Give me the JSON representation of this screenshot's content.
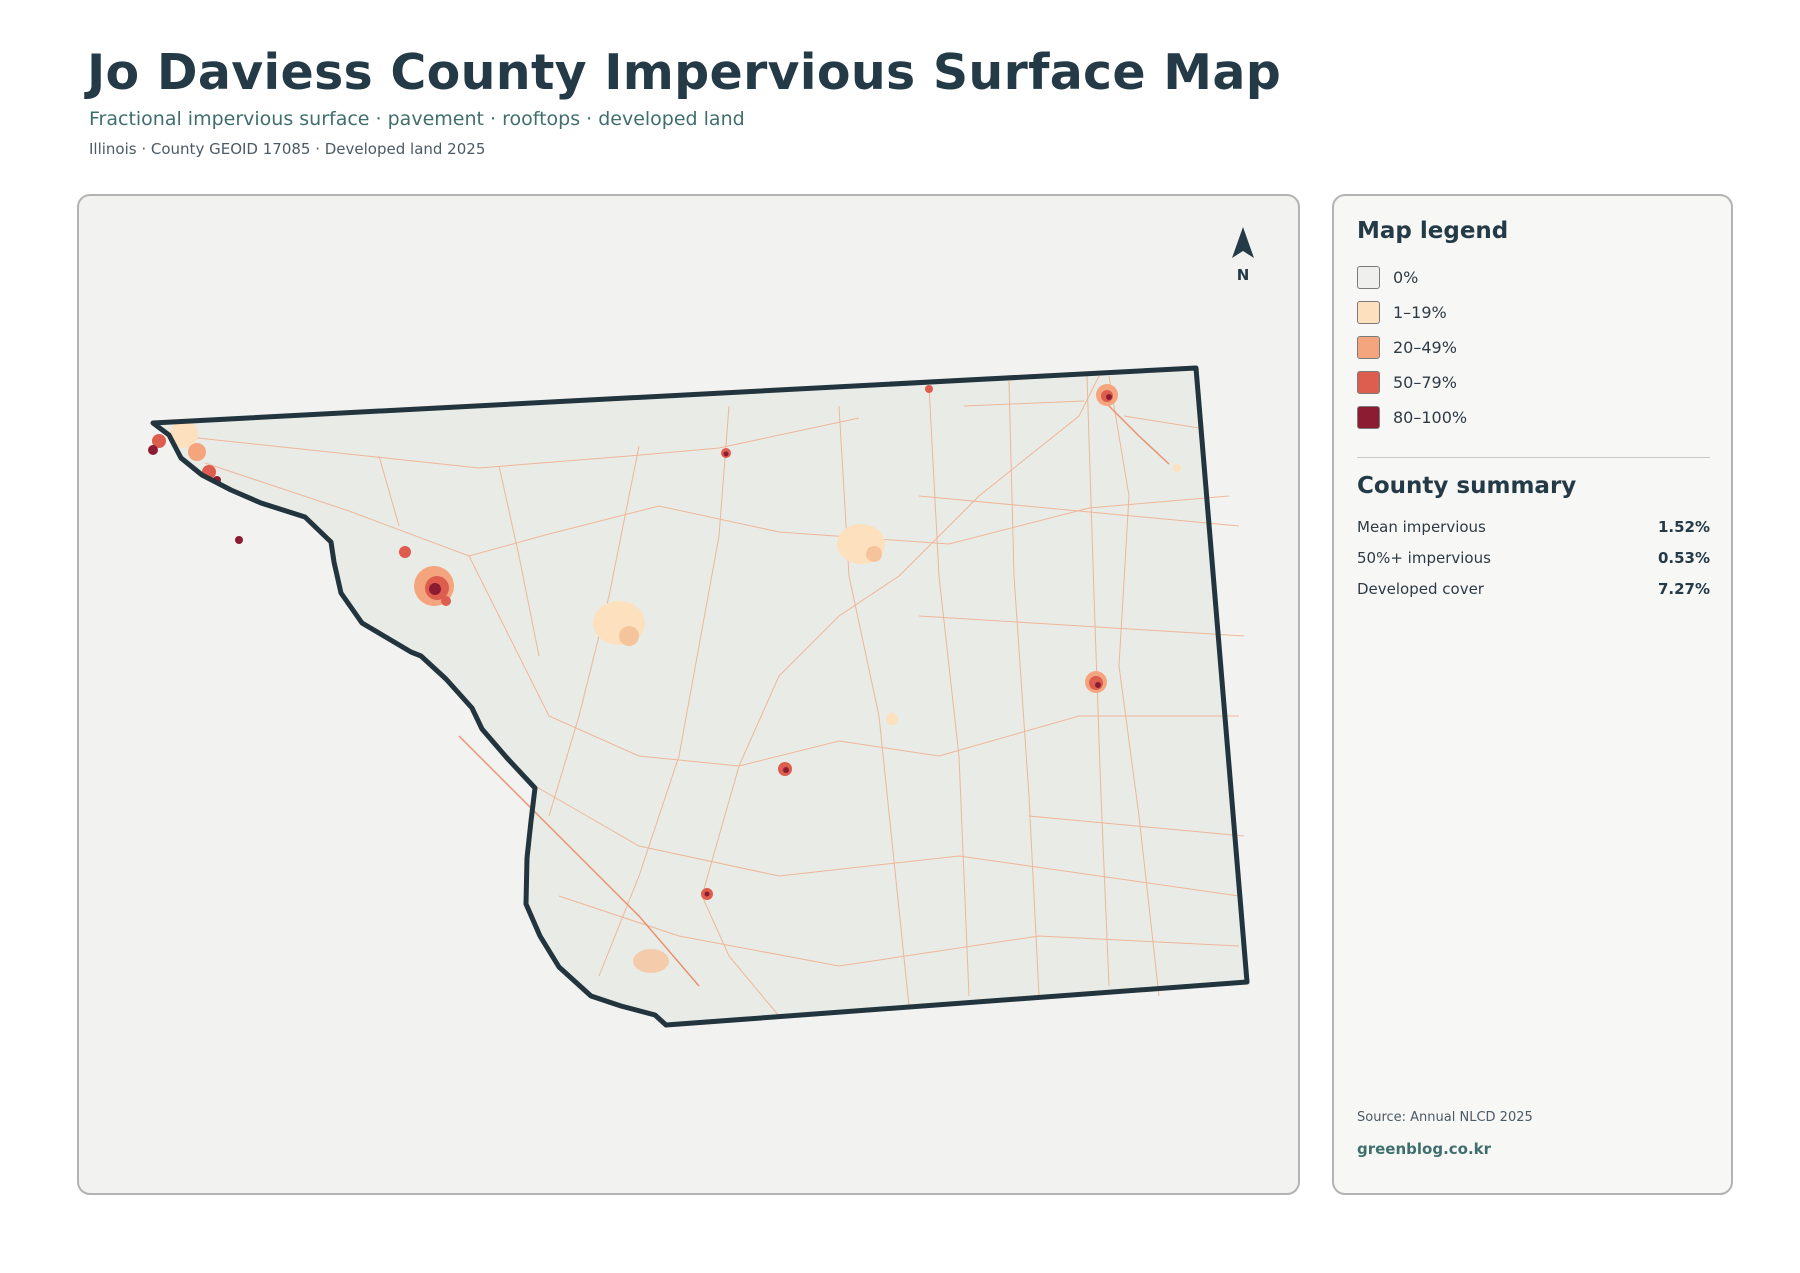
{
  "header": {
    "title": "Jo Daviess County Impervious Surface Map",
    "subtitle": "Fractional impervious surface · pavement · rooftops · developed land",
    "meta": "Illinois · County GEOID 17085 · Developed land 2025"
  },
  "map": {
    "north_label": "N",
    "county_fill": "#e9ebe6",
    "boundary_color": "#22343d",
    "road_color": "#f0a57f",
    "towns": [
      {
        "name": "",
        "class": "80–100%"
      },
      {
        "name": "",
        "class": "50–79%"
      }
    ]
  },
  "legend": {
    "title": "Map legend",
    "items": [
      {
        "label": "0%",
        "color": "#efefed"
      },
      {
        "label": "1–19%",
        "color": "#fde0bd"
      },
      {
        "label": "20–49%",
        "color": "#f4a57e"
      },
      {
        "label": "50–79%",
        "color": "#dd5d4e"
      },
      {
        "label": "80–100%",
        "color": "#8c1c32"
      }
    ]
  },
  "summary": {
    "title": "County summary",
    "stats": [
      {
        "label": "Mean impervious",
        "value": "1.52%"
      },
      {
        "label": "50%+ impervious",
        "value": "0.53%"
      },
      {
        "label": "Developed cover",
        "value": "7.27%"
      }
    ]
  },
  "footer": {
    "source": "Source: Annual NLCD 2025",
    "credit": "greenblog.co.kr"
  }
}
